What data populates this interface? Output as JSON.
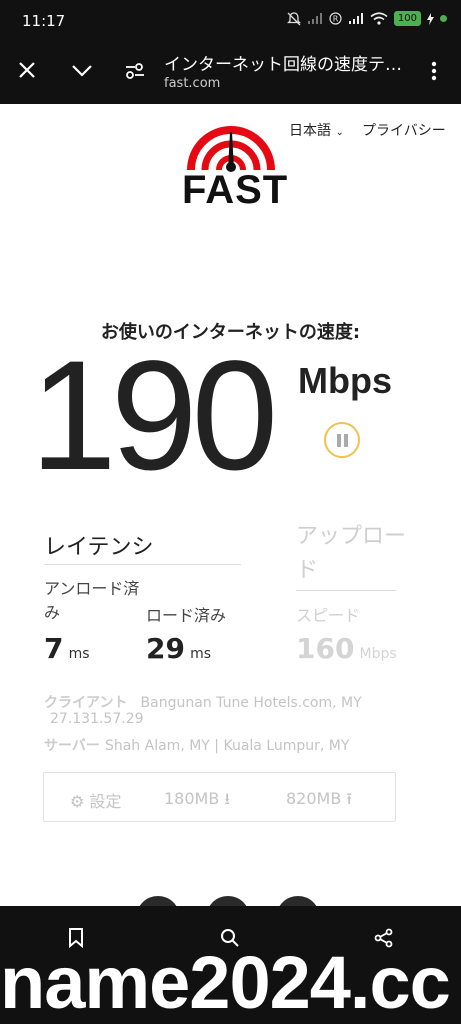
{
  "status_bar": {
    "time": "11:17",
    "battery": "100"
  },
  "browser": {
    "page_title": "インターネット回線の速度テ…",
    "url": "fast.com"
  },
  "header": {
    "language": "日本語",
    "privacy": "プライバシー",
    "logo_text": "FAST"
  },
  "speed": {
    "heading": "お使いのインターネットの速度:",
    "value": "190",
    "units": "Mbps"
  },
  "latency": {
    "title": "レイテンシ",
    "unloaded_label": "アンロード済み",
    "unloaded_value": "7",
    "unloaded_unit": "ms",
    "loaded_label": "ロード済み",
    "loaded_value": "29",
    "loaded_unit": "ms"
  },
  "upload": {
    "title": "アップロード",
    "speed_label": "スピード",
    "value": "160",
    "unit": "Mbps"
  },
  "info": {
    "client_label": "クライアント",
    "client_value": "Bangunan Tune Hotels.com, MY",
    "client_ip": "27.131.57.29",
    "server_label": "サーバー",
    "server_value": "Shah Alam, MY | Kuala Lumpur, MY"
  },
  "settings": {
    "label": "設定",
    "download_size": "180MB",
    "upload_size": "820MB"
  },
  "watermark": "name2024.cc",
  "colors": {
    "chrome_bg": "#111111",
    "logo_red": "#e50914",
    "pause_ring": "#f2c14e",
    "battery_green": "#4caf50"
  }
}
